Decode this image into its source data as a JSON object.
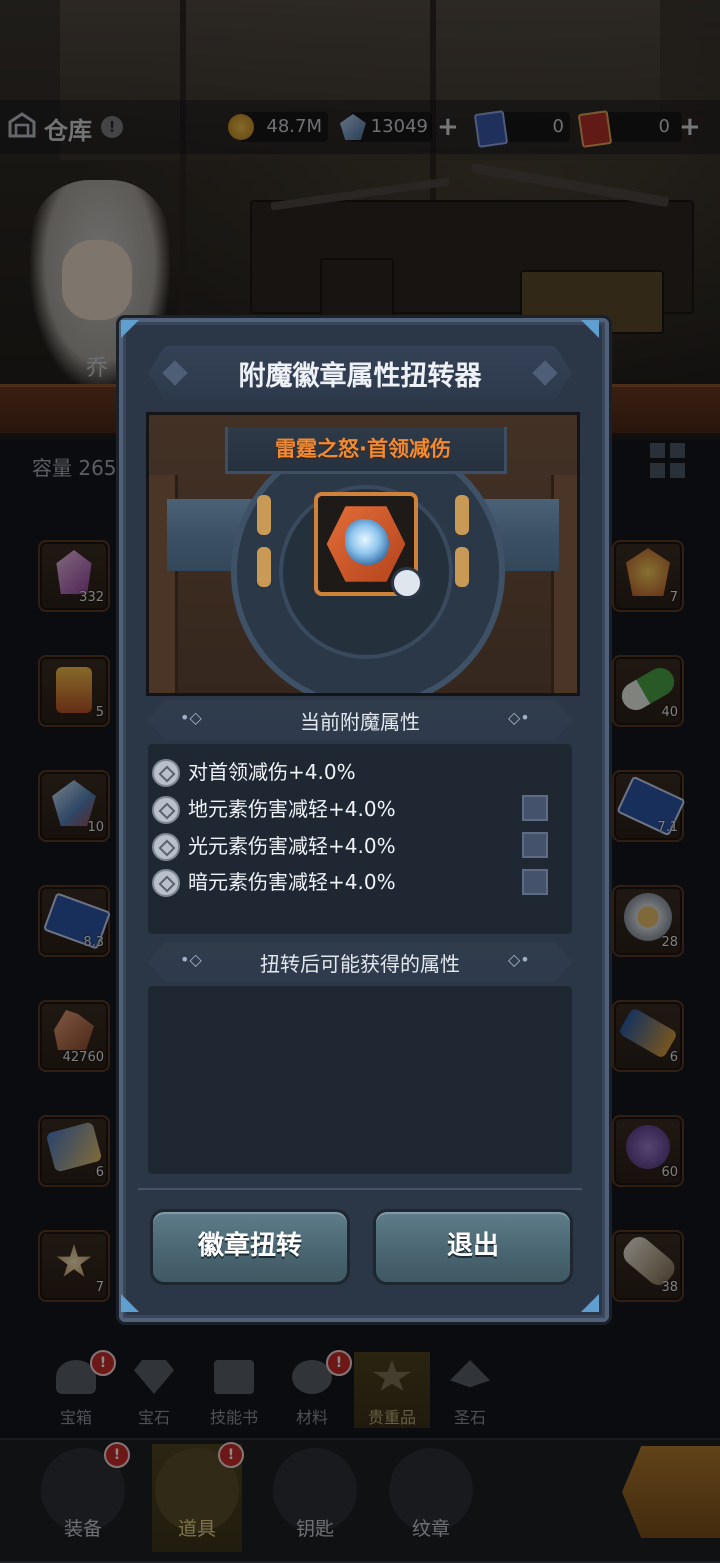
{
  "header": {
    "title": "仓库",
    "help_badge": "!",
    "gold": "48.7M",
    "crystals": "13049",
    "ticket_a": "0",
    "ticket_b": "0",
    "plus": "+"
  },
  "hero": {
    "name_tab": "乔"
  },
  "inventory": {
    "capacity_label": "容量 265",
    "left_items": [
      {
        "icon": "purple-crystal-icon",
        "count": "332"
      },
      {
        "icon": "firecracker-icon",
        "count": "5"
      },
      {
        "icon": "ice-crystal-icon",
        "count": "10"
      },
      {
        "icon": "star-scroll-icon",
        "count": "8.3"
      },
      {
        "icon": "copper-ore-icon",
        "count": "42760"
      },
      {
        "icon": "scroll-bundle-icon",
        "count": "6"
      },
      {
        "icon": "spark-icon",
        "count": "7"
      }
    ],
    "right_items": [
      {
        "icon": "gold-medal-icon",
        "count": "7"
      },
      {
        "icon": "green-capsule-icon",
        "count": "40"
      },
      {
        "icon": "star-ticket-icon",
        "count": "7.1"
      },
      {
        "icon": "angel-halo-icon",
        "count": "28"
      },
      {
        "icon": "blue-scroll-icon",
        "count": "6"
      },
      {
        "icon": "purple-coin-icon",
        "count": "60"
      },
      {
        "icon": "bandage-roll-icon",
        "count": "38"
      }
    ]
  },
  "modal": {
    "title": "附魔徽章属性扭转器",
    "badge_name": "雷霆之怒·首领减伤",
    "current_section": "当前附魔属性",
    "attributes": [
      {
        "text": "对首领减伤+4.0%",
        "has_lock": false
      },
      {
        "text": "地元素伤害减轻+4.0%",
        "has_lock": true
      },
      {
        "text": "光元素伤害减轻+4.0%",
        "has_lock": true
      },
      {
        "text": "暗元素伤害减轻+4.0%",
        "has_lock": true
      }
    ],
    "possible_section": "扭转后可能获得的属性",
    "twist_button": "徽章扭转",
    "exit_button": "退出"
  },
  "sub_tabs": [
    {
      "label": "宝箱",
      "icon": "chest-icon",
      "badge": "!"
    },
    {
      "label": "宝石",
      "icon": "gem-icon",
      "badge": ""
    },
    {
      "label": "技能书",
      "icon": "book-icon",
      "badge": ""
    },
    {
      "label": "材料",
      "icon": "materials-icon",
      "badge": "!"
    },
    {
      "label": "贵重品",
      "icon": "valuables-icon",
      "badge": "",
      "active": true
    },
    {
      "label": "圣石",
      "icon": "holy-stone-icon",
      "badge": ""
    }
  ],
  "nav": [
    {
      "label": "装备",
      "icon": "equipment-icon",
      "badge": "!"
    },
    {
      "label": "道具",
      "icon": "items-icon",
      "badge": "!",
      "active": true
    },
    {
      "label": "钥匙",
      "icon": "key-icon",
      "badge": ""
    },
    {
      "label": "纹章",
      "icon": "emblem-icon",
      "badge": ""
    }
  ],
  "colors": {
    "modal_bg": "#2b3646",
    "badge_name": "#f08a34",
    "button": "#4a6672"
  }
}
